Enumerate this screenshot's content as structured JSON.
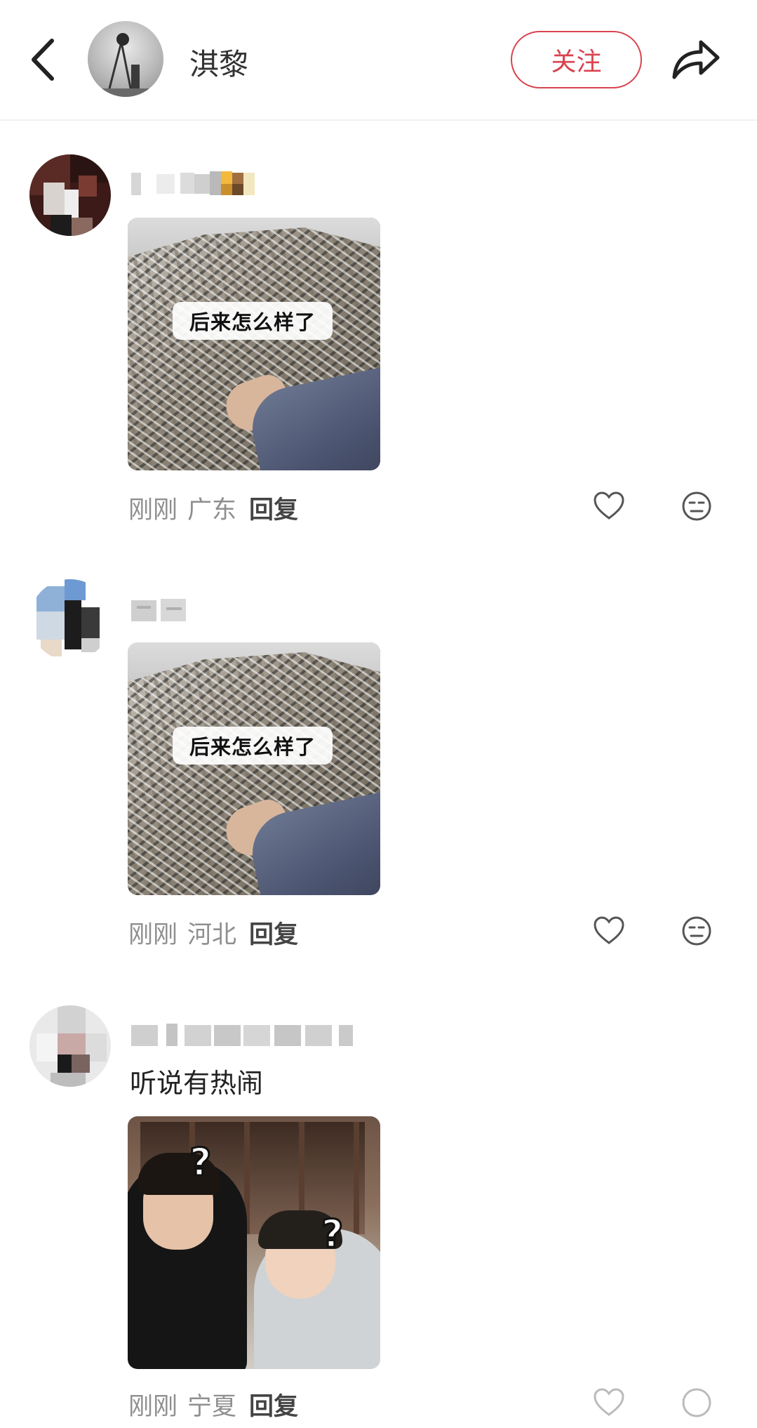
{
  "header": {
    "title": "淇黎",
    "follow_label": "关注",
    "icons": {
      "back": "chevron-left-icon",
      "share": "share-arrow-icon"
    }
  },
  "comments": [
    {
      "username": "",
      "text": "",
      "image_caption": "后来怎么样了",
      "time": "刚刚",
      "location": "广东",
      "reply_label": "回复"
    },
    {
      "username": "",
      "text": "",
      "image_caption": "后来怎么样了",
      "time": "刚刚",
      "location": "河北",
      "reply_label": "回复"
    },
    {
      "username": "",
      "text": "听说有热闹",
      "image_caption": "",
      "image_overlay": [
        "?",
        "?"
      ],
      "time": "刚刚",
      "location": "宁夏",
      "reply_label": "回复"
    }
  ],
  "colors": {
    "accent": "#d9434f",
    "meta": "#8f8f8f",
    "username": "#a7a7a7"
  }
}
